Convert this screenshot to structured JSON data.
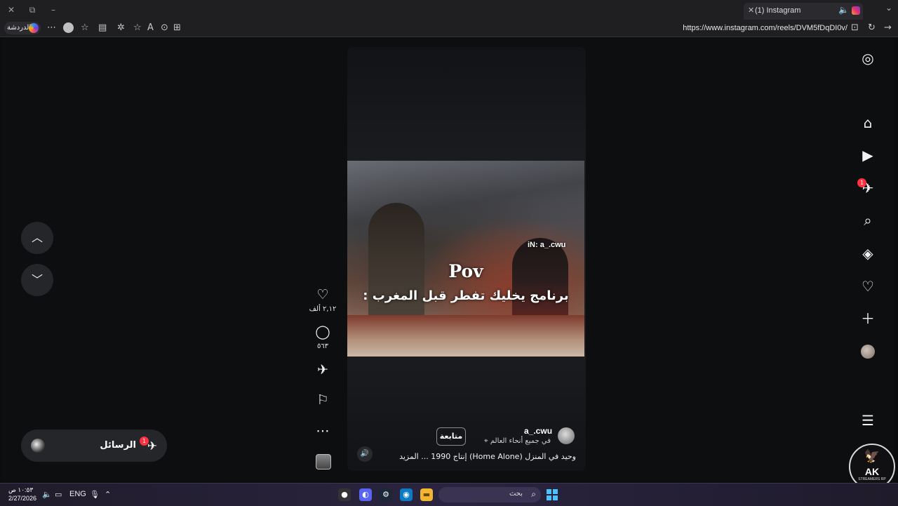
{
  "browser": {
    "tab_title": "(1) Instagram",
    "url": "https://www.instagram.com/reels/DVM5fDqDI0v/",
    "chat_label": "الدردشة"
  },
  "reel": {
    "watermark": "iN: a_.cwu",
    "caption_title": "Pov",
    "caption_text": "برنامج يخليك تفطر قبل المغرب :",
    "author": "a_.cwu",
    "location": "في جميع أنحاء العالم",
    "follow_label": "متابعة",
    "description": "وحيد في المنزل (Home Alone) إنتاج 1990 ... المزيد",
    "likes": "٢,١٢ ألف",
    "comments": "٥٦٣"
  },
  "nav": {
    "messages_badge": "1"
  },
  "messages": {
    "label": "الرسائل",
    "badge": "1"
  },
  "logo": {
    "main": "AK",
    "sub": "STREAMERS RP"
  },
  "taskbar": {
    "time": "١٠:٥٣ ص",
    "date": "2/27/2026",
    "language": "ENG",
    "search_placeholder": "بحث"
  }
}
